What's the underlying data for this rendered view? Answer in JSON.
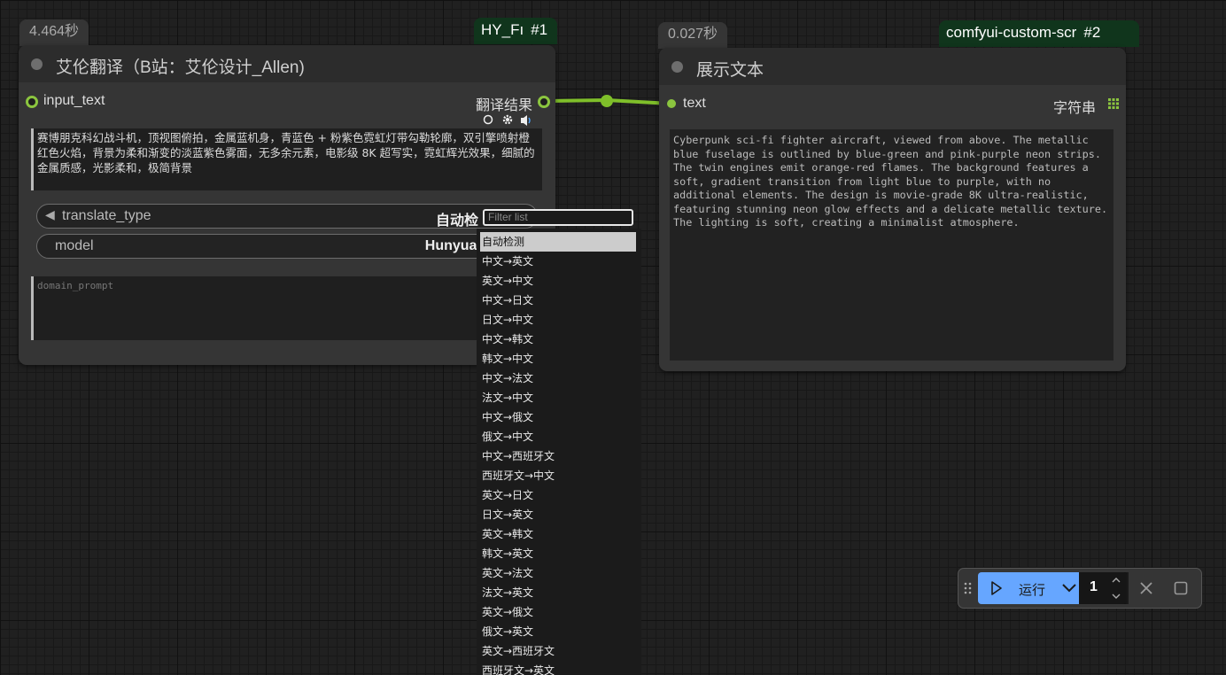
{
  "node1": {
    "time": "4.464秒",
    "badge_name": "HY_Fı",
    "badge_num": "#1",
    "title": "艾伦翻译（B站：艾伦设计_Allen)",
    "input_label": "input_text",
    "output_label": "翻译结果",
    "input_text": "赛博朋克科幻战斗机，顶视图俯拍，金属蓝机身，青蓝色 + 粉紫色霓虹灯带勾勒轮廓，双引擎喷射橙红色火焰，背景为柔和渐变的淡蓝紫色雾面，无多余元素，电影级 8K 超写实，霓虹辉光效果，细腻的金属质感，光影柔和，极简背景",
    "widget_translate_name": "translate_type",
    "widget_translate_value": "自动检",
    "widget_model_name": "model",
    "widget_model_value": "Hunyuan-I",
    "domain_prompt_placeholder": "domain_prompt"
  },
  "node2": {
    "time": "0.027秒",
    "badge_name": "comfyui-custom-scr",
    "badge_num": "#2",
    "title": "展示文本",
    "input_label": "text",
    "output_label": "字符串",
    "text": "Cyberpunk sci-fi fighter aircraft, viewed from above. The metallic\nblue fuselage is outlined by blue-green and pink-purple neon strips.\nThe twin engines emit orange-red flames. The background features a\nsoft, gradient transition from light blue to purple, with no\nadditional elements. The design is movie-grade 8K ultra-realistic,\nfeaturing stunning neon glow effects and a delicate metallic texture.\nThe lighting is soft, creating a minimalist atmosphere."
  },
  "dropdown": {
    "filter_placeholder": "Filter list",
    "selected_index": 0,
    "options": [
      "自动检测",
      "中文→英文",
      "英文→中文",
      "中文→日文",
      "日文→中文",
      "中文→韩文",
      "韩文→中文",
      "中文→法文",
      "法文→中文",
      "中文→俄文",
      "俄文→中文",
      "中文→西班牙文",
      "西班牙文→中文",
      "英文→日文",
      "日文→英文",
      "英文→韩文",
      "韩文→英文",
      "英文→法文",
      "法文→英文",
      "英文→俄文",
      "俄文→英文",
      "英文→西班牙文",
      "西班牙文→英文"
    ]
  },
  "runbar": {
    "run_label": "运行",
    "count": "1"
  },
  "colors": {
    "accent_green": "#8bc53f",
    "run_blue": "#66a6ff",
    "badge_green": "#10351c"
  },
  "icons": [
    "drag-handle-icon",
    "play-icon",
    "chevron-down-icon",
    "chevron-up-icon",
    "close-icon",
    "stop-square-icon",
    "circle-icon",
    "gear-icon",
    "speaker-icon",
    "grid-icon"
  ]
}
